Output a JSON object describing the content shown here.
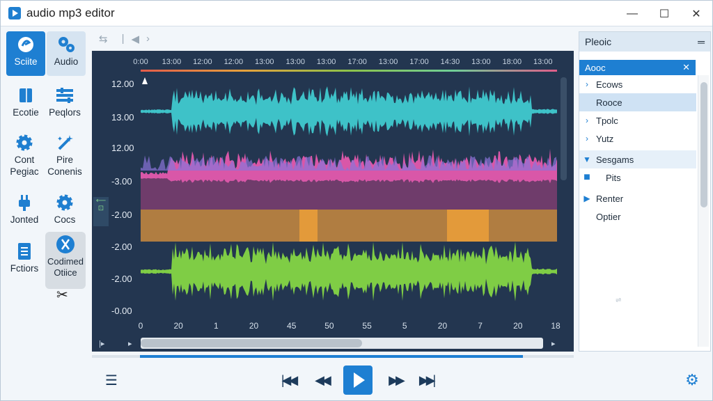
{
  "window": {
    "title": "audio mp3 editor",
    "minimize": "—",
    "maximize": "☐",
    "close": "✕"
  },
  "tools": [
    {
      "label": "Sciite",
      "icon": "edit-circle-icon"
    },
    {
      "label": "Audio",
      "icon": "gear-cluster-icon"
    },
    {
      "label": "Ecotie",
      "icon": "book-icon"
    },
    {
      "label": "Peqlors",
      "icon": "sliders-icon"
    },
    {
      "label": "Cont Pegiac",
      "icon": "gear-icon"
    },
    {
      "label": "Pire Conenis",
      "icon": "magic-wand-icon"
    },
    {
      "label": "Jonted",
      "icon": "plug-icon"
    },
    {
      "label": "Cocs",
      "icon": "gear-icon"
    },
    {
      "label": "Fctiors",
      "icon": "document-icon"
    },
    {
      "label": "Codimed Otiice",
      "icon": "scissors-icon"
    }
  ],
  "ruler_top": [
    "0:00",
    "13:00",
    "12:00",
    "12:00",
    "13:00",
    "13:00",
    "13:00",
    "17:00",
    "13:00",
    "17:00",
    "14:30",
    "13:00",
    "18:00",
    "13:00"
  ],
  "y_labels": [
    "12.00",
    "13.00",
    "12.00",
    "-3.00",
    "-2.00",
    "-2.00",
    "-2.00",
    "-0.00"
  ],
  "ruler_bottom": [
    "0",
    "20",
    "1",
    "20",
    "45",
    "50",
    "55",
    "5",
    "20",
    "7",
    "20",
    "18"
  ],
  "tracks": [
    {
      "color": "#3ec2c8",
      "type": "wave"
    },
    {
      "color": "#d957a8",
      "type": "wave",
      "accent": "#8a74d8"
    },
    {
      "color": "#c98a3e",
      "type": "block"
    },
    {
      "color": "#7fcd45",
      "type": "wave"
    }
  ],
  "playback": {
    "progress": 0.88
  },
  "panel": {
    "title": "Pleoic",
    "menu": "═",
    "sub_title": "Aooc",
    "sub_close": "✕",
    "items": [
      {
        "label": "Ecows",
        "marker": "›"
      },
      {
        "label": "Rooce",
        "marker": ""
      },
      {
        "label": "Tpolc",
        "marker": "›"
      },
      {
        "label": "Yutz",
        "marker": "›"
      },
      {
        "label": "Sesgams",
        "marker": "▼"
      },
      {
        "label": "Pits",
        "marker": "■"
      },
      {
        "label": "Renter",
        "marker": "▶"
      },
      {
        "label": "Optier",
        "marker": ""
      }
    ]
  },
  "colors": {
    "accent": "#1e7fd2",
    "wave_bg": "#233650"
  }
}
